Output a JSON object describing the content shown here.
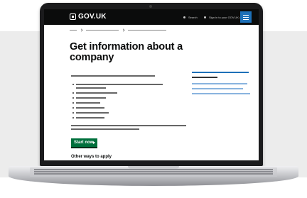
{
  "header": {
    "logo_text": "GOV.UK",
    "nav_search": "Search",
    "nav_account": "Sign in to your GOV.UK account"
  },
  "main": {
    "title": "Get information about a company",
    "start_button_label": "Start now",
    "other_ways_heading": "Other ways to apply"
  },
  "colors": {
    "header_background": "#0b0c0c",
    "menu_button": "#1d70b8",
    "start_button": "#00703c"
  }
}
